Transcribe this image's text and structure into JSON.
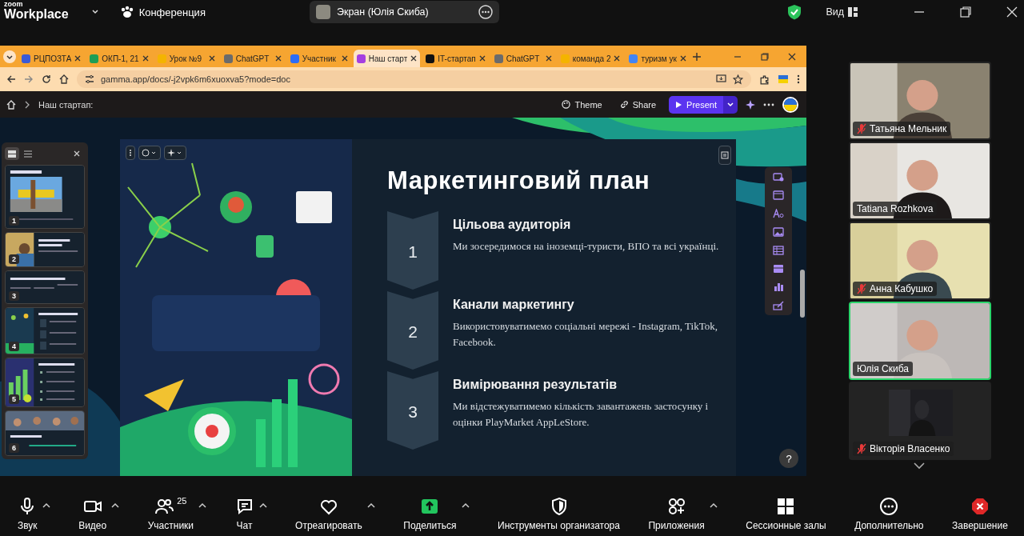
{
  "top_bar": {
    "app_name_small": "zoom",
    "app_name": "Workplace",
    "meeting_label": "Конференция",
    "share_label": "Экран (Юлія Скиба)",
    "view_label": "Вид"
  },
  "browser": {
    "tabs": [
      {
        "label": "РЦПОЗТА",
        "selected": false,
        "color": "#3b5bd6"
      },
      {
        "label": "ОКП-1, 21",
        "selected": false,
        "color": "#1e9e55"
      },
      {
        "label": "Урок №9",
        "selected": false,
        "color": "#f4b400"
      },
      {
        "label": "ChatGPT",
        "selected": false,
        "color": "#6b6b6b"
      },
      {
        "label": "Участник",
        "selected": false,
        "color": "#2d6df6"
      },
      {
        "label": "Наш старт",
        "selected": true,
        "color": "#a53fe0"
      },
      {
        "label": "IT-стартап",
        "selected": false,
        "color": "#111111"
      },
      {
        "label": "ChatGPT",
        "selected": false,
        "color": "#6b6b6b"
      },
      {
        "label": "команда 2",
        "selected": false,
        "color": "#f4b400"
      },
      {
        "label": "туризм ук",
        "selected": false,
        "color": "#4285f4"
      }
    ],
    "url": "gamma.app/docs/-j2vpk6m6xuoxva5?mode=doc"
  },
  "doc_toolbar": {
    "breadcrumb": "Наш стартап:",
    "theme_label": "Theme",
    "share_label": "Share",
    "present_label": "Present"
  },
  "thumbnails": [
    {
      "number": "1"
    },
    {
      "number": "2"
    },
    {
      "number": "3"
    },
    {
      "number": "4"
    },
    {
      "number": "5"
    },
    {
      "number": "6"
    }
  ],
  "slide": {
    "title": "Маркетинговий план",
    "steps": [
      {
        "number": "1",
        "heading": "Цільова аудиторія",
        "text": "Ми зосередимося на іноземці-туристи, ВПО та всі українці."
      },
      {
        "number": "2",
        "heading": "Канали маркетингу",
        "text": "Використовуватимемо соціальні мережі - Instagram, TikTok, Facebook."
      },
      {
        "number": "3",
        "heading": "Вимірювання результатів",
        "text": "Ми відстежуватимемо кількість завантажень застосунку і оцінки PlayMarket AppLeStore."
      }
    ]
  },
  "help_label": "?",
  "participants": [
    {
      "name": "Татьяна Мельник",
      "muted": true,
      "selected": false
    },
    {
      "name": "Tatiana Rozhkova",
      "muted": false,
      "selected": false
    },
    {
      "name": "Анна Кабушко",
      "muted": true,
      "selected": false
    },
    {
      "name": "Юлія Скиба",
      "muted": false,
      "selected": true
    },
    {
      "name": "Вікторія Власенко",
      "muted": true,
      "selected": false
    }
  ],
  "toolbar": [
    {
      "kind": "audio",
      "label": "Звук",
      "menu": true
    },
    {
      "kind": "video",
      "label": "Видео",
      "menu": true
    },
    {
      "kind": "participants",
      "label": "Участники",
      "count": "25",
      "menu": true
    },
    {
      "kind": "chat",
      "label": "Чат",
      "menu": true
    },
    {
      "kind": "react",
      "label": "Отреагировать",
      "menu": true
    },
    {
      "kind": "share",
      "label": "Поделиться",
      "menu": true
    },
    {
      "kind": "host",
      "label": "Инструменты организатора",
      "menu": false
    },
    {
      "kind": "apps",
      "label": "Приложения",
      "menu": true
    },
    {
      "kind": "rooms",
      "label": "Сессионные залы",
      "menu": false
    },
    {
      "kind": "more",
      "label": "Дополнительно",
      "menu": false
    },
    {
      "kind": "end",
      "label": "Завершение",
      "menu": false
    }
  ]
}
